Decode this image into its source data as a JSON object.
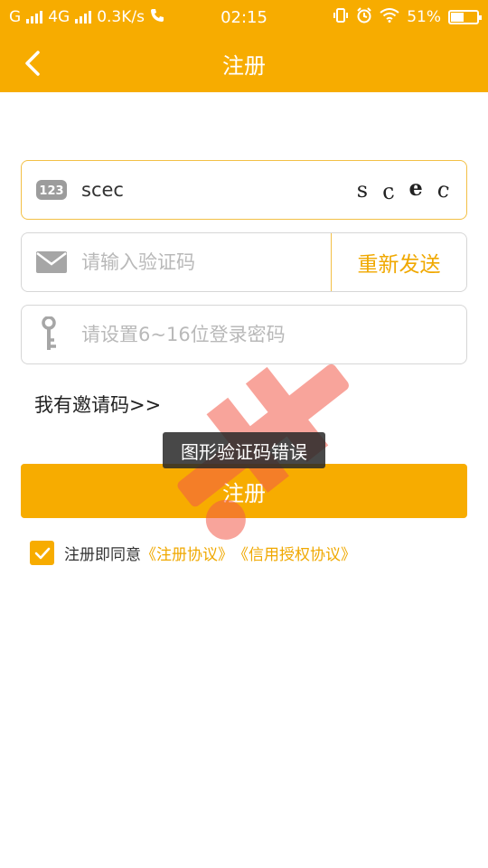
{
  "status_bar": {
    "carrier1": "G",
    "carrier2": "4G",
    "speed": "0.3K/s",
    "time": "02:15",
    "battery_percent": "51%",
    "battery_level": 0.51
  },
  "header": {
    "title": "注册",
    "back_icon": "chevron-left-icon"
  },
  "form": {
    "captcha_field": {
      "value": "scec",
      "icon": "number-123-icon",
      "captcha_chars": [
        "s",
        "c",
        "e",
        "c"
      ]
    },
    "sms_field": {
      "placeholder": "请输入验证码",
      "icon": "mail-icon",
      "resend_label": "重新发送"
    },
    "password_field": {
      "placeholder": "请设置6~16位登录密码",
      "icon": "key-icon"
    },
    "invite_link": "我有邀请码>>",
    "toast": "图形验证码错误",
    "submit_label": "注册",
    "agreement": {
      "checked": true,
      "prefix": "注册即同意",
      "link1": "《注册协议》",
      "link2": "《信用授权协议》"
    }
  },
  "colors": {
    "accent": "#f7ac00",
    "link": "#f0a800"
  }
}
